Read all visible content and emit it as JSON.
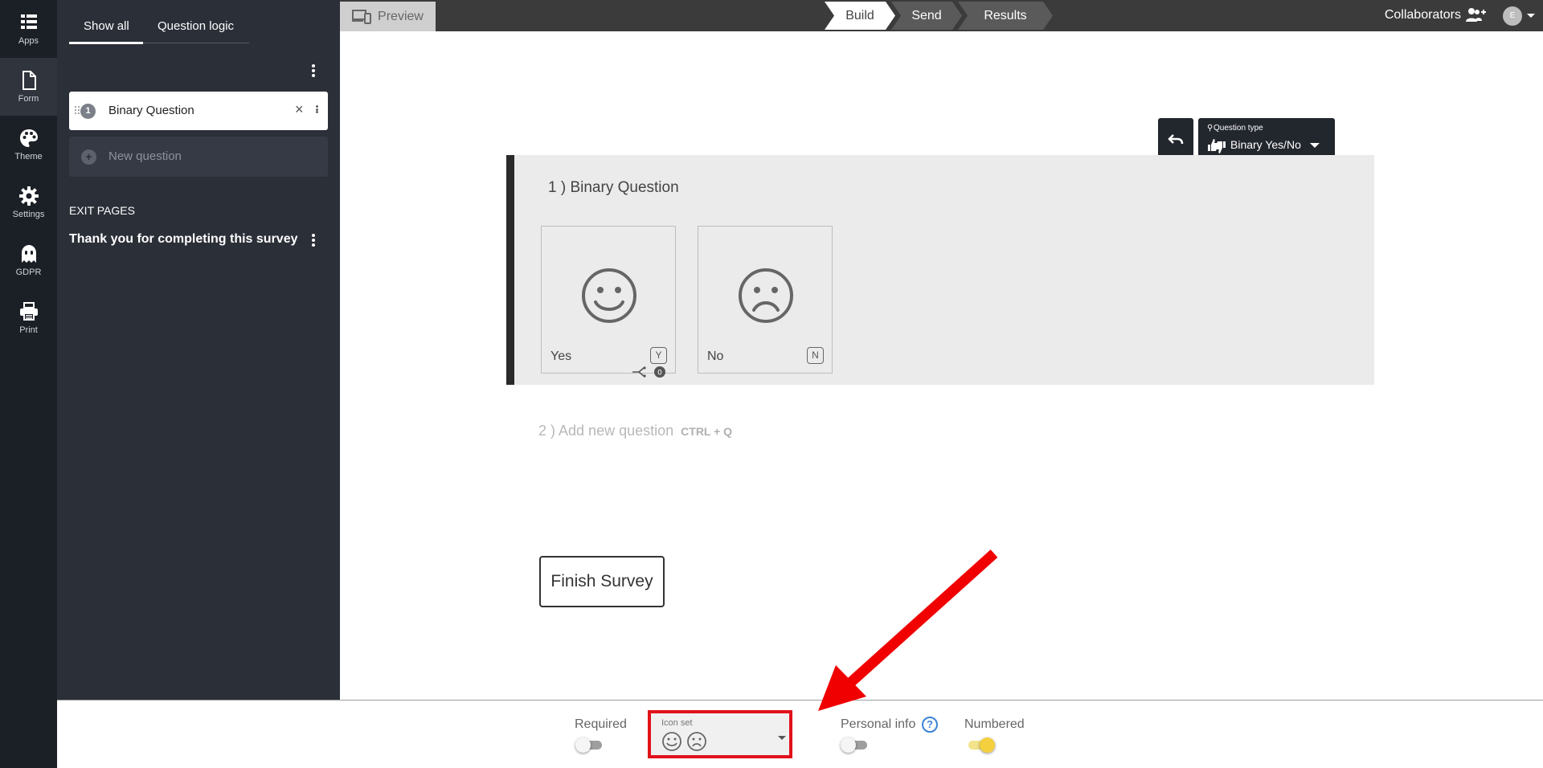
{
  "rail": {
    "items": [
      {
        "label": "Apps",
        "icon": "apps-grid-icon"
      },
      {
        "label": "Form",
        "icon": "form-document-icon"
      },
      {
        "label": "Theme",
        "icon": "palette-icon"
      },
      {
        "label": "Settings",
        "icon": "gear-icon"
      },
      {
        "label": "GDPR",
        "icon": "ghost-icon"
      },
      {
        "label": "Print",
        "icon": "printer-icon"
      }
    ],
    "active": "Form"
  },
  "sidebar": {
    "tabs": [
      "Show all",
      "Question logic"
    ],
    "active_tab": "Show all",
    "questions": [
      {
        "number": "1",
        "title": "Binary Question"
      }
    ],
    "new_question_label": "New question",
    "exit_pages_heading": "EXIT PAGES",
    "exit_pages": [
      "Thank you for completing this survey"
    ]
  },
  "topbar": {
    "preview_label": "Preview",
    "steps": [
      "Build",
      "Send",
      "Results"
    ],
    "active_step": "Build",
    "collaborators_label": "Collaborators",
    "avatar_initial": "E"
  },
  "editor": {
    "question_type_label": "Question type",
    "question_type_value": "Binary Yes/No",
    "question_number": "1 )",
    "question_title": "Binary Question",
    "choices": [
      {
        "label": "Yes",
        "key": "Y",
        "face": "smile-face-icon"
      },
      {
        "label": "No",
        "key": "N",
        "face": "frown-face-icon"
      }
    ],
    "add_question_number": "2 )",
    "add_question_label": "Add new question",
    "add_question_shortcut": "CTRL + Q",
    "finish_button_label": "Finish Survey"
  },
  "bottom_toolbar": {
    "required_label": "Required",
    "required_on": false,
    "icon_set_label": "Icon set",
    "personal_info_label": "Personal info",
    "personal_info_on": false,
    "numbered_label": "Numbered",
    "numbered_on": true
  },
  "colors": {
    "highlight_red": "#e0111a",
    "toggle_on_yellow": "#f4d03f",
    "help_blue": "#3b82d6",
    "sidebar_dark": "#2b2f38",
    "rail_dark": "#1b1f26"
  }
}
